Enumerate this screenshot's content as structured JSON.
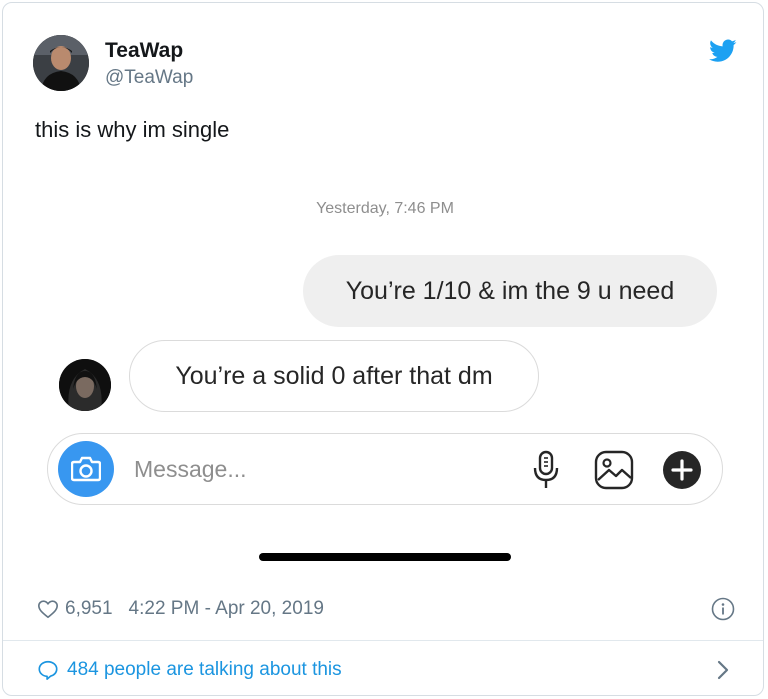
{
  "tweet": {
    "author_name": "TeaWap",
    "author_handle": "@TeaWap",
    "text": "this is why im single",
    "likes": "6,951",
    "timestamp": "4:22 PM - Apr 20, 2019",
    "conversation": "484 people are talking about this"
  },
  "dm": {
    "timestamp": "Yesterday, 7:46 PM",
    "outgoing_message": "You’re 1/10 & im the 9 u need",
    "incoming_message": "You’re a solid 0 after that dm",
    "composer_placeholder": "Message..."
  },
  "colors": {
    "twitter_blue": "#1da1f2",
    "link_blue": "#1b95e0",
    "camera_blue": "#3897f0",
    "muted_gray": "#657786"
  },
  "icons": [
    "twitter-bird-icon",
    "camera-icon",
    "microphone-icon",
    "gallery-icon",
    "plus-icon",
    "heart-icon",
    "info-icon",
    "reply-bubble-icon",
    "chevron-right-icon"
  ]
}
